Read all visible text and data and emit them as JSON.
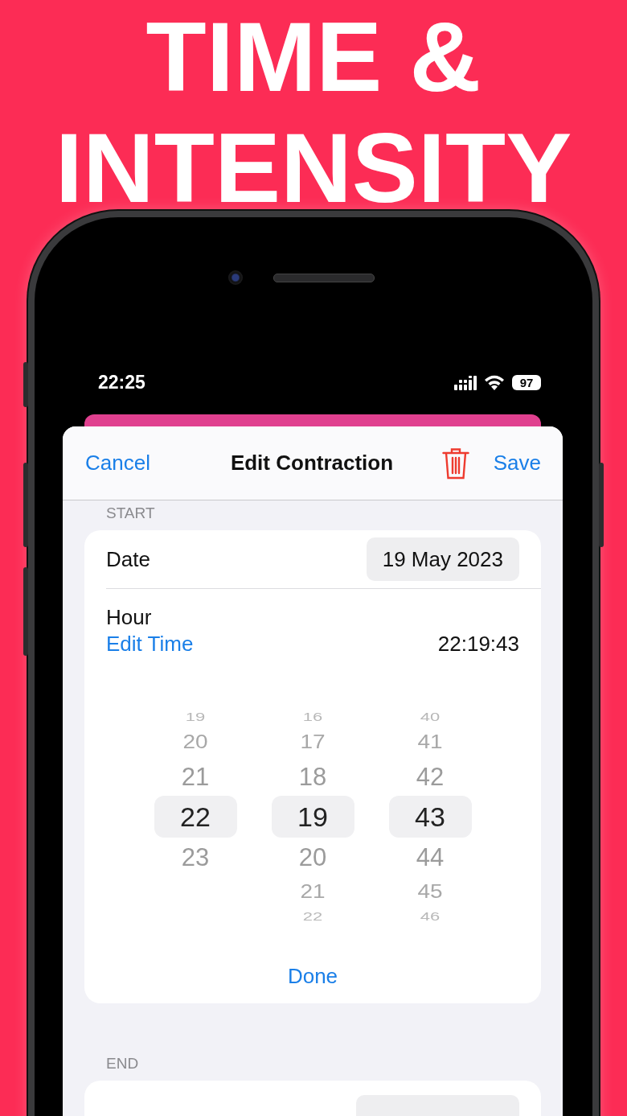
{
  "headline": "TIME & INTENSITY",
  "status_bar": {
    "time": "22:25",
    "battery": "97"
  },
  "sheet": {
    "cancel": "Cancel",
    "title": "Edit Contraction",
    "save": "Save"
  },
  "start": {
    "label": "START",
    "date_label": "Date",
    "date": "19 May 2023",
    "hour_label": "Hour",
    "edit_link": "Edit Time",
    "time": "22:19:43",
    "picker": {
      "columns": [
        {
          "values": [
            {
              "text": "19",
              "selected": false
            },
            {
              "text": "20",
              "selected": false
            },
            {
              "text": "21",
              "selected": false
            },
            {
              "text": "22",
              "selected": true
            },
            {
              "text": "23",
              "selected": false
            }
          ]
        },
        {
          "values": [
            {
              "text": "16",
              "selected": false
            },
            {
              "text": "17",
              "selected": false
            },
            {
              "text": "18",
              "selected": false
            },
            {
              "text": "19",
              "selected": true
            },
            {
              "text": "20",
              "selected": false
            },
            {
              "text": "21",
              "selected": false
            },
            {
              "text": "22",
              "selected": false
            }
          ]
        },
        {
          "values": [
            {
              "text": "40",
              "selected": false
            },
            {
              "text": "41",
              "selected": false
            },
            {
              "text": "42",
              "selected": false
            },
            {
              "text": "43",
              "selected": true
            },
            {
              "text": "44",
              "selected": false
            },
            {
              "text": "45",
              "selected": false
            },
            {
              "text": "46",
              "selected": false
            }
          ]
        }
      ]
    },
    "done": "Done"
  },
  "end": {
    "label": "END"
  }
}
